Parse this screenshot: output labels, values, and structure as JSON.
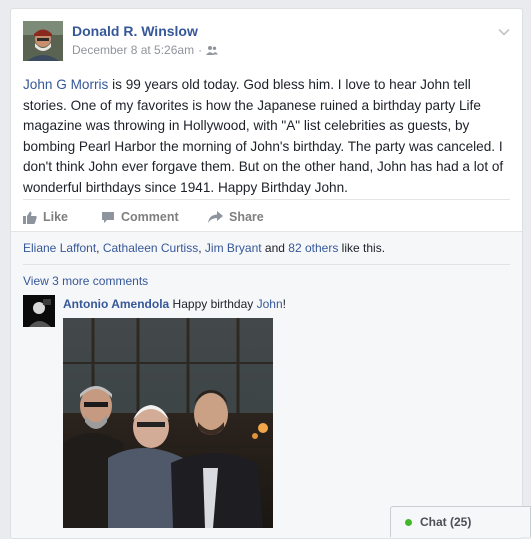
{
  "post": {
    "author": "Donald R. Winslow",
    "timestamp": "December 8 at 5:26am",
    "separator": "·",
    "audience_icon": "friends-icon",
    "menu_icon": "chevron-down-icon",
    "text": {
      "mention": "John G Morris",
      "body": " is 99 years old today. God bless him. I love to hear John tell stories. One of my favorites is how the Japanese ruined a birthday party Life magazine was throwing in Hollywood, with \"A\" list celebrities as guests, by bombing Pearl Harbor the morning of John's birthday. The party was canceled. I don't think John ever forgave them. But on the other hand, John has had a lot of wonderful birthdays since 1941. Happy Birthday John."
    }
  },
  "actions": {
    "like": "Like",
    "comment": "Comment",
    "share": "Share"
  },
  "likes": {
    "names": [
      "Eliane Laffont",
      "Cathaleen Curtiss",
      "Jim Bryant"
    ],
    "others_count": "82 others",
    "suffix": " like this.",
    "and": " and ",
    "comma": ", "
  },
  "comments": {
    "view_more": "View 3 more comments",
    "items": [
      {
        "author": "Antonio Amendola",
        "text_before": " Happy birthday ",
        "mention": "John",
        "text_after": "!",
        "has_photo": true
      }
    ]
  },
  "chat": {
    "label": "Chat (25)",
    "status_color": "#42b72a"
  },
  "colors": {
    "link": "#365899",
    "text": "#1d2129",
    "muted": "#90949c"
  }
}
